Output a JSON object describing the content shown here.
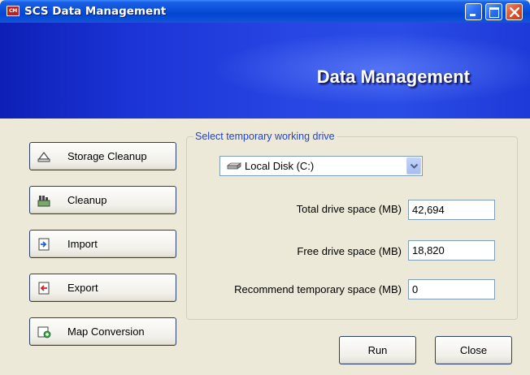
{
  "window": {
    "title": "SCS Data Management",
    "app_icon_text": "CM"
  },
  "banner": {
    "title": "Data Management"
  },
  "sidebar": {
    "buttons": [
      {
        "label": "Storage Cleanup",
        "icon": "storage-cleanup-icon"
      },
      {
        "label": "Cleanup",
        "icon": "cleanup-icon"
      },
      {
        "label": "Import",
        "icon": "import-icon"
      },
      {
        "label": "Export",
        "icon": "export-icon"
      },
      {
        "label": "Map Conversion",
        "icon": "map-conversion-icon"
      }
    ]
  },
  "drive_group": {
    "legend": "Select temporary working drive",
    "selected_drive": "Local Disk (C:)",
    "fields": {
      "total_label": "Total drive space (MB)",
      "total_value": "42,694",
      "free_label": "Free drive space (MB)",
      "free_value": "18,820",
      "recommend_label": "Recommend temporary space (MB)",
      "recommend_value": "0"
    }
  },
  "actions": {
    "run_label": "Run",
    "close_label": "Close"
  },
  "colors": {
    "banner": "#1c34d6",
    "legend_text": "#1e44d8",
    "window_face": "#ece9d8"
  }
}
